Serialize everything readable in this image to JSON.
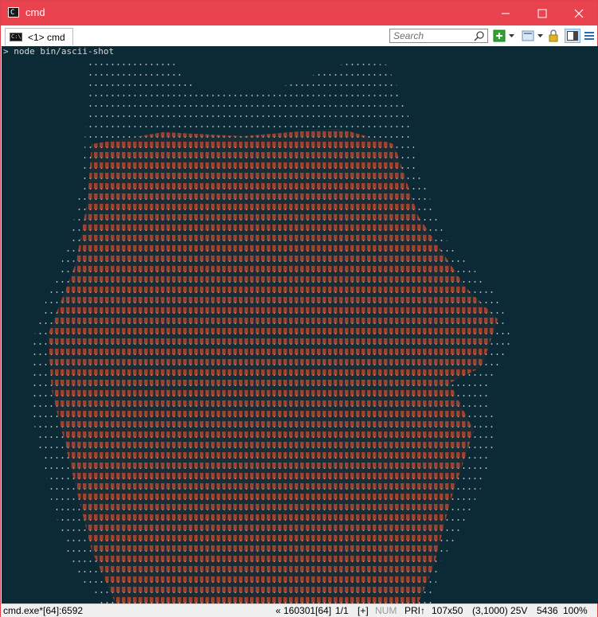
{
  "window": {
    "title": "cmd"
  },
  "titlebar": {
    "app_icon": "console-icon",
    "minimize_icon": "minimize-icon",
    "maximize_icon": "maximize-icon",
    "close_icon": "close-icon"
  },
  "toolbar": {
    "tab_label": "<1> cmd",
    "search_placeholder": "Search",
    "buttons": [
      "new-console-icon",
      "dropdown-arrow-icon",
      "info-icon",
      "dropdown-arrow-icon",
      "split-view-icon",
      "menu-icon"
    ]
  },
  "terminal": {
    "prompt": "> node bin/ascii-shot",
    "art_colors": {
      "dots": "#d9d9d9",
      "orange": "#c9492c",
      "background": "#0c2a36"
    }
  },
  "status": {
    "process": "cmd.exe*[64]:6592",
    "pos": "« 160301[64]",
    "pages": "1/1",
    "mode": "[+]",
    "num": "NUM",
    "pri": "PRI↑",
    "size": "107x50",
    "cursor": "(3,1000) 25V",
    "pid": "5436",
    "zoom": "100%"
  },
  "colors": {
    "titlebar": "#e8434f",
    "terminal_bg": "#0c2a36",
    "art": "#c9492c"
  }
}
